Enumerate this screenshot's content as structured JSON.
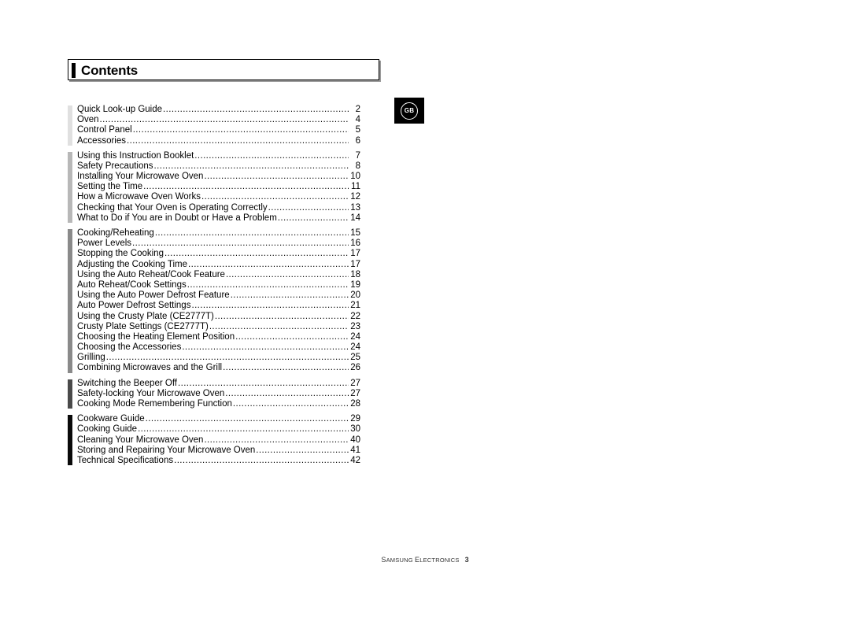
{
  "page": {
    "title": "Contents",
    "locale_badge": "GB"
  },
  "footer": {
    "brand_part1": "S",
    "brand_part2": "AMSUNG",
    "brand_part3": "E",
    "brand_part4": "LECTRONICS",
    "page_number": "3"
  },
  "colors": {
    "group_bar_1": "#e0e0e0",
    "group_bar_2": "#b8b8b8",
    "group_bar_3": "#8a8a8a",
    "group_bar_4": "#4a4a4a",
    "group_bar_5": "#0a0a0a",
    "text": "#000000",
    "badge_background": "#000000"
  },
  "toc": {
    "groups": [
      {
        "bar_color": "#e0e0e0",
        "entries": [
          {
            "title": "Quick Look-up Guide",
            "page": "2"
          },
          {
            "title": "Oven ",
            "page": "4"
          },
          {
            "title": "Control Panel",
            "page": "5"
          },
          {
            "title": "Accessories ",
            "page": "6"
          }
        ]
      },
      {
        "bar_color": "#b8b8b8",
        "entries": [
          {
            "title": "Using this Instruction Booklet ",
            "page": "7"
          },
          {
            "title": "Safety Precautions",
            "page": "8"
          },
          {
            "title": "Installing Your Microwave Oven",
            "page": "10"
          },
          {
            "title": "Setting the Time ",
            "page": "11"
          },
          {
            "title": "How a Microwave Oven Works ",
            "page": "12"
          },
          {
            "title": "Checking that Your Oven is Operating Correctly",
            "page": "13"
          },
          {
            "title": "What to Do if You are in Doubt or Have a Problem",
            "page": "14"
          }
        ]
      },
      {
        "bar_color": "#8a8a8a",
        "entries": [
          {
            "title": "Cooking/Reheating",
            "page": "15"
          },
          {
            "title": "Power Levels ",
            "page": "16"
          },
          {
            "title": "Stopping the Cooking",
            "page": "17"
          },
          {
            "title": "Adjusting the Cooking Time ",
            "page": "17"
          },
          {
            "title": "Using the Auto Reheat/Cook Feature ",
            "page": "18"
          },
          {
            "title": "Auto Reheat/Cook Settings ",
            "page": "19"
          },
          {
            "title": "Using the Auto Power Defrost Feature ",
            "page": "20"
          },
          {
            "title": "Auto Power Defrost Settings  ",
            "page": "21"
          },
          {
            "title": "Using the Crusty Plate (CE2777T) ",
            "page": "22"
          },
          {
            "title": "Crusty Plate Settings (CE2777T) ",
            "page": "23"
          },
          {
            "title": "Choosing the Heating Element Position ",
            "page": "24"
          },
          {
            "title": "Choosing the Accessories  ",
            "page": "24"
          },
          {
            "title": "Grilling ",
            "page": "25"
          },
          {
            "title": "Combining Microwaves and the Grill  ",
            "page": "26"
          }
        ]
      },
      {
        "bar_color": "#4a4a4a",
        "entries": [
          {
            "title": "Switching the Beeper Off  ",
            "page": "27"
          },
          {
            "title": "Safety-locking Your Microwave Oven  ",
            "page": "27"
          },
          {
            "title": "Cooking Mode Remembering Function  ",
            "page": "28"
          }
        ]
      },
      {
        "bar_color": "#0a0a0a",
        "entries": [
          {
            "title": "Cookware Guide  ",
            "page": "29"
          },
          {
            "title": "Cooking Guide ",
            "page": "30"
          },
          {
            "title": "Cleaning Your Microwave Oven",
            "page": "40"
          },
          {
            "title": "Storing and Repairing Your Microwave Oven  ",
            "page": "41"
          },
          {
            "title": "Technical Specifications ",
            "page": "42"
          }
        ]
      }
    ]
  }
}
